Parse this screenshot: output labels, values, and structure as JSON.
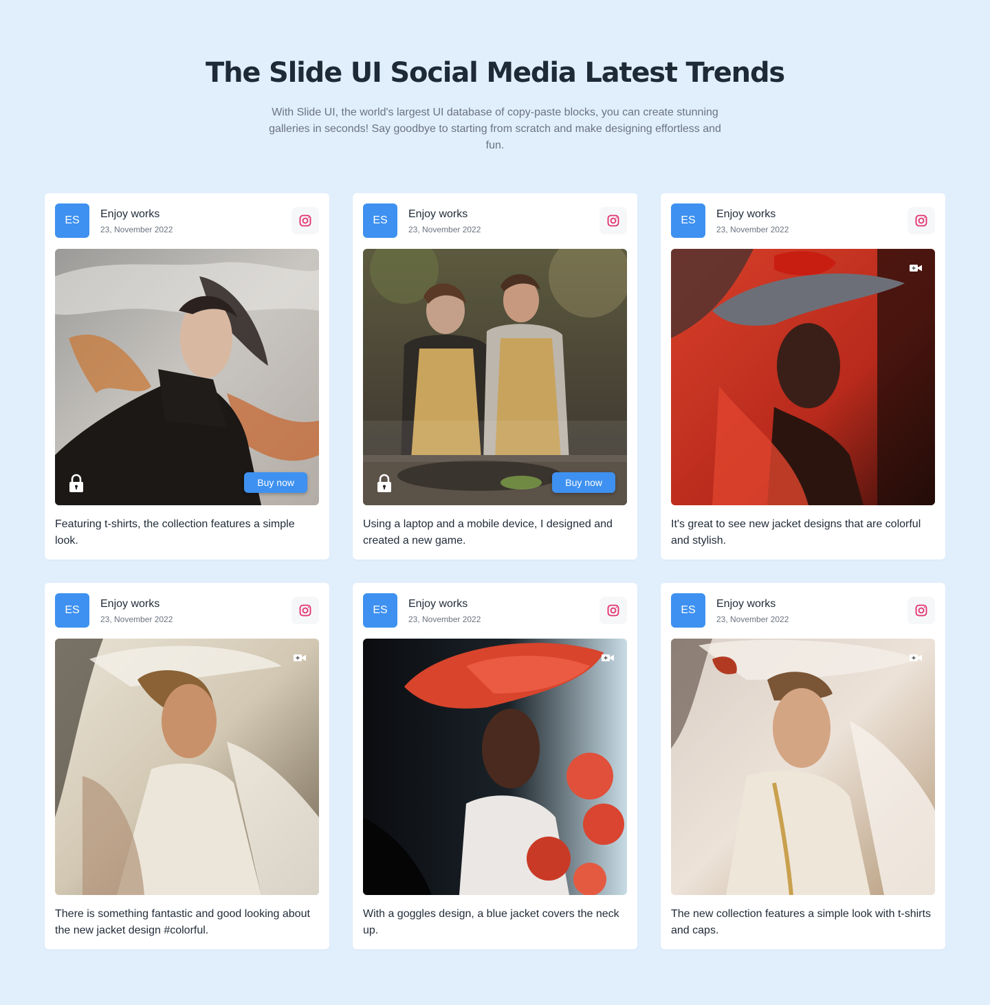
{
  "header": {
    "title": "The Slide UI Social Media Latest Trends",
    "description": "With Slide UI, the world's largest UI database of copy-paste blocks, you can create stunning galleries in seconds! Say goodbye to starting from scratch and make designing effortless and fun."
  },
  "colors": {
    "page_background": "#e1effc",
    "accent": "#3e91f0",
    "instagram": "#e1306c",
    "heading": "#1f2a37",
    "muted": "#6b7280"
  },
  "cards": [
    {
      "avatar": "ES",
      "author": "Enjoy works",
      "date": "23, November 2022",
      "media_icon": "lock-icon",
      "buy_label": "Buy now",
      "caption": "Featuring t-shirts, the collection features a simple look."
    },
    {
      "avatar": "ES",
      "author": "Enjoy works",
      "date": "23, November 2022",
      "media_icon": "lock-icon",
      "buy_label": "Buy now",
      "caption": "Using a laptop and a mobile device, I designed and created a new game."
    },
    {
      "avatar": "ES",
      "author": "Enjoy works",
      "date": "23, November 2022",
      "media_icon": "video-icon",
      "caption": "It's great to see new jacket designs that are colorful and stylish."
    },
    {
      "avatar": "ES",
      "author": "Enjoy works",
      "date": "23, November 2022",
      "media_icon": "video-icon",
      "caption": "There is something fantastic and good looking about the new jacket design #colorful."
    },
    {
      "avatar": "ES",
      "author": "Enjoy works",
      "date": "23, November 2022",
      "media_icon": "video-icon",
      "caption": "With a goggles design, a blue jacket covers the neck up."
    },
    {
      "avatar": "ES",
      "author": "Enjoy works",
      "date": "23, November 2022",
      "media_icon": "video-icon",
      "caption": "The new collection features a simple look with t-shirts and caps."
    }
  ]
}
